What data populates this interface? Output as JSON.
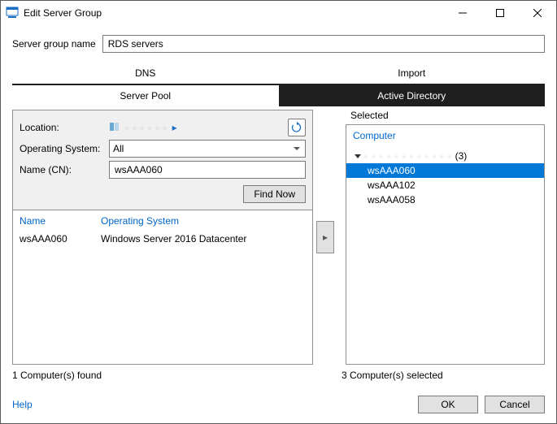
{
  "titlebar": {
    "title": "Edit Server Group"
  },
  "groupName": {
    "label": "Server group name",
    "value": "RDS servers"
  },
  "tabsTop": {
    "dns": "DNS",
    "import": "Import"
  },
  "tabsSub": {
    "pool": "Server Pool",
    "ad": "Active Directory"
  },
  "filter": {
    "locationLabel": "Location:",
    "locationPath": "· · · · · ·",
    "osLabel": "Operating System:",
    "osValue": "All",
    "nameLabel": "Name (CN):",
    "nameValue": "wsAAA060",
    "findNow": "Find Now"
  },
  "results": {
    "columns": {
      "name": "Name",
      "os": "Operating System"
    },
    "rows": [
      {
        "name": "wsAAA060",
        "os": "Windows Server 2016 Datacenter"
      }
    ],
    "countText": "1 Computer(s) found"
  },
  "selected": {
    "panelLabel": "Selected",
    "columnLabel": "Computer",
    "rootLabel": "· · · · · · · · · · · ·",
    "rootCount": "(3)",
    "items": [
      {
        "name": "wsAAA060",
        "selected": true
      },
      {
        "name": "wsAAA102",
        "selected": false
      },
      {
        "name": "wsAAA058",
        "selected": false
      }
    ],
    "countText": "3 Computer(s) selected"
  },
  "footer": {
    "help": "Help",
    "ok": "OK",
    "cancel": "Cancel"
  }
}
